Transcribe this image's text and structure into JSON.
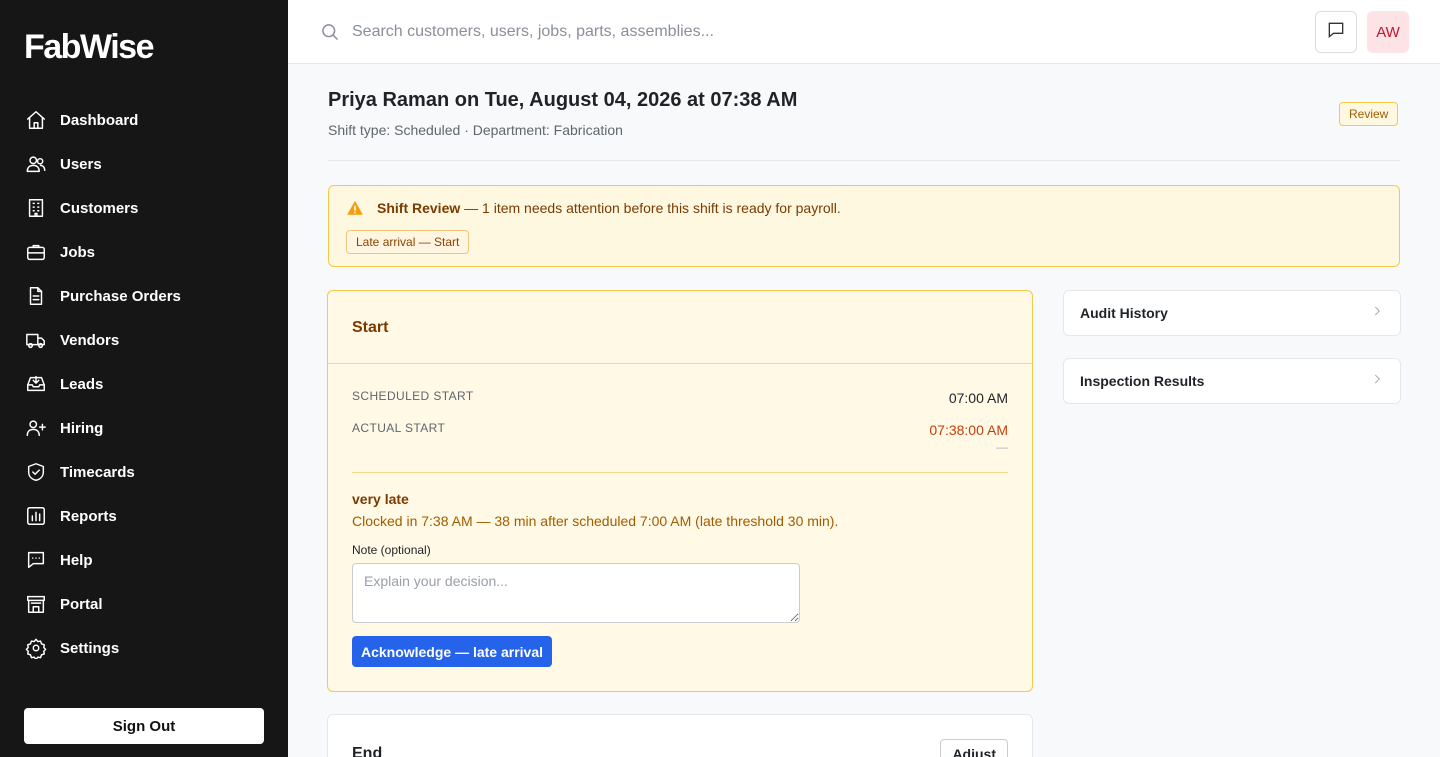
{
  "app": {
    "logo": "FabWise"
  },
  "sidebar": {
    "items": [
      {
        "label": "Dashboard",
        "icon": "home-icon"
      },
      {
        "label": "Users",
        "icon": "users-icon"
      },
      {
        "label": "Customers",
        "icon": "building-icon"
      },
      {
        "label": "Jobs",
        "icon": "briefcase-icon"
      },
      {
        "label": "Purchase Orders",
        "icon": "document-icon"
      },
      {
        "label": "Vendors",
        "icon": "truck-icon"
      },
      {
        "label": "Leads",
        "icon": "inbox-icon"
      },
      {
        "label": "Hiring",
        "icon": "user-plus-icon"
      },
      {
        "label": "Timecards",
        "icon": "shield-check-icon"
      },
      {
        "label": "Reports",
        "icon": "bar-chart-icon"
      },
      {
        "label": "Help",
        "icon": "chat-icon"
      },
      {
        "label": "Portal",
        "icon": "storefront-icon"
      },
      {
        "label": "Settings",
        "icon": "gear-icon"
      }
    ],
    "sign_out": "Sign Out"
  },
  "topbar": {
    "search_placeholder": "Search customers, users, jobs, parts, assemblies...",
    "avatar_initials": "AW"
  },
  "header": {
    "title": "Priya Raman on Tue, August 04, 2026 at 07:38 AM",
    "subtitle": "Shift type: Scheduled · Department: Fabrication",
    "status": "Review"
  },
  "alert": {
    "title": "Shift Review",
    "message": " — 1 item needs attention before this shift is ready for payroll.",
    "chip": "Late arrival — Start"
  },
  "start_card": {
    "title": "Start",
    "scheduled_label": "SCHEDULED START",
    "scheduled_value": "07:00 AM",
    "actual_label": "ACTUAL START",
    "actual_value": "07:38:00 AM",
    "actual_sub": "—",
    "late_title": "very late",
    "late_desc": "Clocked in 7:38 AM — 38 min after scheduled 7:00 AM (late threshold 30 min).",
    "note_label": "Note (optional)",
    "note_placeholder": "Explain your decision...",
    "ack_button": "Acknowledge — late arrival"
  },
  "end_card": {
    "title": "End",
    "adjust_button": "Adjust"
  },
  "side_panels": [
    {
      "label": "Audit History"
    },
    {
      "label": "Inspection Results"
    }
  ],
  "colors": {
    "sidebar_bg": "#161616",
    "accent": "#2563eb",
    "warning_bg": "#fff8e1",
    "warning_border": "#f2c94c",
    "warning_text": "#a15c00"
  }
}
